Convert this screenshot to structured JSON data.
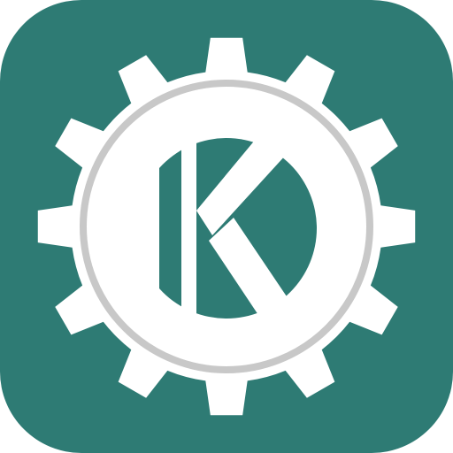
{
  "app_icon": {
    "name": "kde-gear-k-icon",
    "letter": "K",
    "colors": {
      "background": "#2e7b74",
      "gear": "#ffffff",
      "ring": "#c8c8c8",
      "letter": "#ffffff"
    }
  }
}
